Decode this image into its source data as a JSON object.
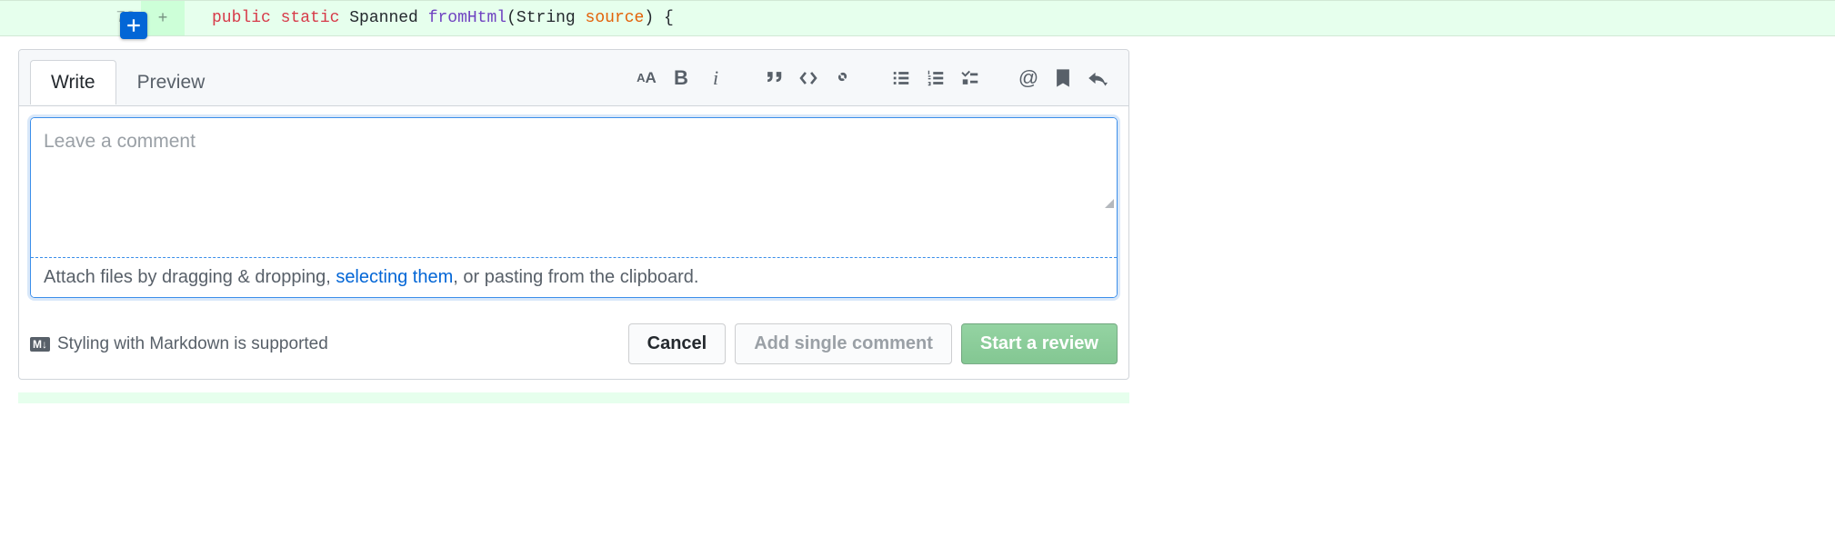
{
  "diff": {
    "line_number": "72",
    "addition_sign": "+",
    "tokens": {
      "kw_public": "public",
      "kw_static": "static",
      "type": "Spanned",
      "fn": "fromHtml",
      "lparen": "(",
      "argtype": "String",
      "argname": "source",
      "rparen": ")",
      "brace": "{"
    }
  },
  "tabs": {
    "write": "Write",
    "preview": "Preview"
  },
  "toolbar": {
    "heading": "A",
    "heading_sm": "A",
    "bold": "B",
    "italic": "i",
    "at": "@"
  },
  "textarea": {
    "placeholder": "Leave a comment"
  },
  "attach": {
    "pre": "Attach files by dragging & dropping, ",
    "link": "selecting them",
    "post": ", or pasting from the clipboard."
  },
  "md_hint": {
    "badge": "M↓",
    "text": "Styling with Markdown is supported"
  },
  "buttons": {
    "cancel": "Cancel",
    "add_single": "Add single comment",
    "start_review": "Start a review"
  }
}
